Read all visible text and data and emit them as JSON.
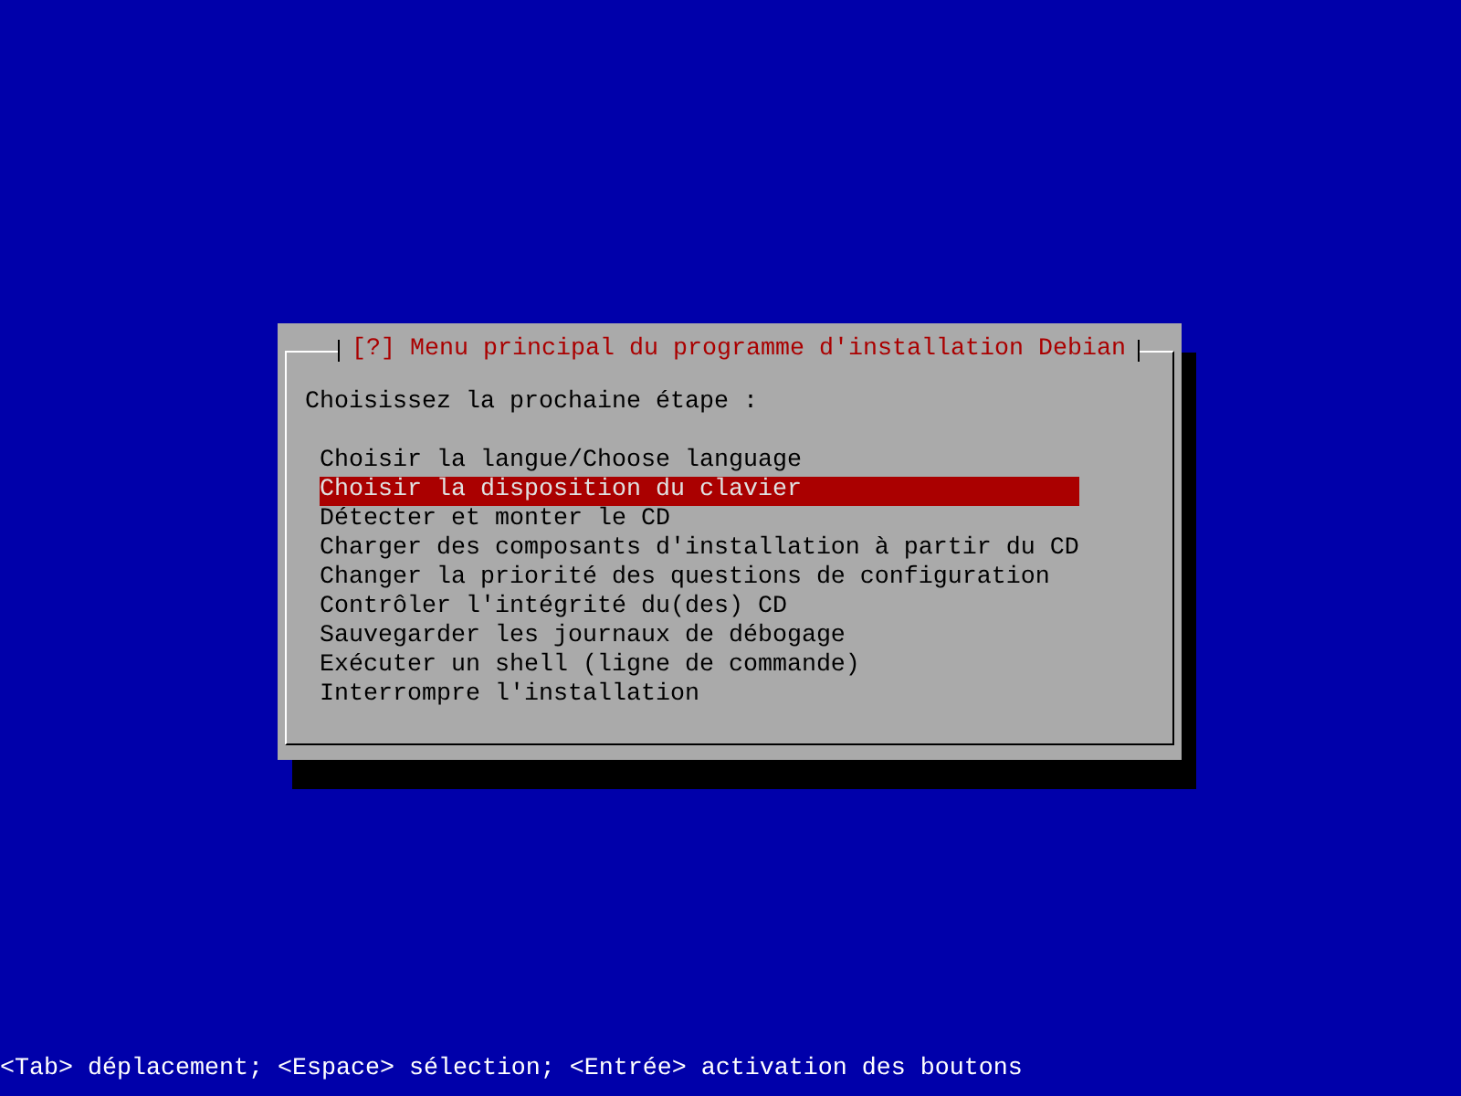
{
  "dialog": {
    "title": "[?] Menu principal du programme d'installation Debian",
    "prompt": "Choisissez la prochaine étape :",
    "items": [
      {
        "label": "Choisir la langue/Choose language",
        "selected": false
      },
      {
        "label": "Choisir la disposition du clavier",
        "selected": true
      },
      {
        "label": "Détecter et monter le CD",
        "selected": false
      },
      {
        "label": "Charger des composants d'installation à partir du CD",
        "selected": false
      },
      {
        "label": "Changer la priorité des questions de configuration",
        "selected": false
      },
      {
        "label": "Contrôler l'intégrité du(des) CD",
        "selected": false
      },
      {
        "label": "Sauvegarder les journaux de débogage",
        "selected": false
      },
      {
        "label": "Exécuter un shell (ligne de commande)",
        "selected": false
      },
      {
        "label": "Interrompre l'installation",
        "selected": false
      }
    ]
  },
  "status_bar": {
    "text": "<Tab> déplacement; <Espace> sélection; <Entrée> activation des boutons"
  }
}
